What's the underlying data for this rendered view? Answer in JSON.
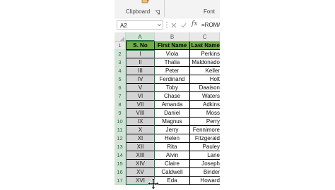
{
  "ribbon": {
    "clipboard_label": "Clipboard",
    "font_label": "Font"
  },
  "formula_bar": {
    "name_box": "A2",
    "formula": "=ROMAN(ROW()-1)",
    "fx_label": "fx"
  },
  "columns": [
    {
      "letter": "A",
      "selected": true
    },
    {
      "letter": "B",
      "selected": false
    },
    {
      "letter": "C",
      "selected": false
    }
  ],
  "table": {
    "headers": [
      "S. No",
      "First Name",
      "Last Name"
    ],
    "rows": [
      {
        "row": "2",
        "sno": "I",
        "first": "Viola",
        "last": "Perkins"
      },
      {
        "row": "3",
        "sno": "II",
        "first": "Thalia",
        "last": "Maldonado"
      },
      {
        "row": "4",
        "sno": "III",
        "first": "Peter",
        "last": "Keller"
      },
      {
        "row": "5",
        "sno": "IV",
        "first": "Ferdinand",
        "last": "Holt"
      },
      {
        "row": "6",
        "sno": "V",
        "first": "Toby",
        "last": "Daaison"
      },
      {
        "row": "7",
        "sno": "VI",
        "first": "Chase",
        "last": "Waters"
      },
      {
        "row": "8",
        "sno": "VII",
        "first": "Amanda",
        "last": "Adkins"
      },
      {
        "row": "9",
        "sno": "VIII",
        "first": "Daniel",
        "last": "Moss"
      },
      {
        "row": "10",
        "sno": "IX",
        "first": "Magnus",
        "last": "Perry"
      },
      {
        "row": "11",
        "sno": "X",
        "first": "Jerry",
        "last": "Fennimore"
      },
      {
        "row": "12",
        "sno": "XI",
        "first": "Helen",
        "last": "Fitzgerald"
      },
      {
        "row": "13",
        "sno": "XII",
        "first": "Rita",
        "last": "Pauley"
      },
      {
        "row": "14",
        "sno": "XIII",
        "first": "Alvin",
        "last": "Lane"
      },
      {
        "row": "15",
        "sno": "XIV",
        "first": "Claire",
        "last": "Joseph"
      },
      {
        "row": "16",
        "sno": "XV",
        "first": "Caldwell",
        "last": "Binder"
      },
      {
        "row": "17",
        "sno": "XVI",
        "first": "Eda",
        "last": "Howard"
      }
    ],
    "header_row_num": "1"
  },
  "colors": {
    "header_fill": "#70ad47",
    "selection": "#217346",
    "selected_cells": "#d4d4d4"
  }
}
